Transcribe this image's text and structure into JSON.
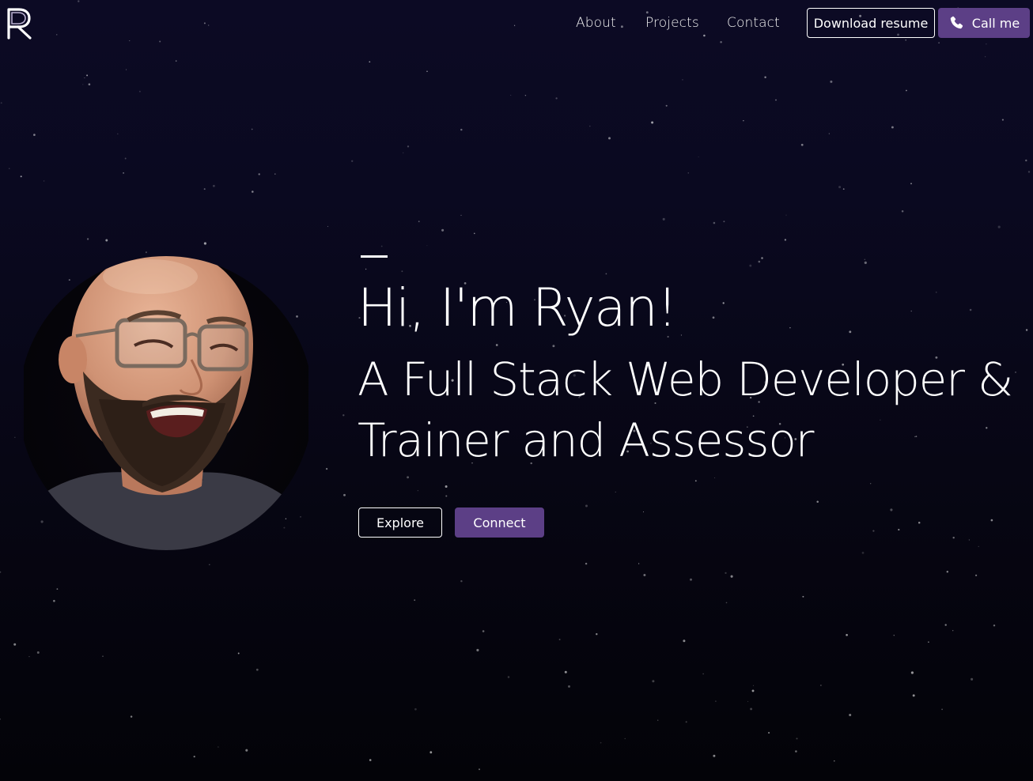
{
  "brand": {
    "logo_letter": "R"
  },
  "nav": {
    "links": [
      "About",
      "Projects",
      "Contact"
    ],
    "download_label": "Download resume",
    "call_label": "Call me",
    "call_icon": "phone-icon"
  },
  "hero": {
    "greeting": "Hi, I'm Ryan!",
    "tagline_line1": "A Full Stack Web Developer &",
    "tagline_line2": "Trainer and Assessor",
    "explore_label": "Explore",
    "connect_label": "Connect"
  },
  "colors": {
    "accent": "#5c3f86",
    "background": "#0a0920",
    "text": "#ffffff"
  }
}
